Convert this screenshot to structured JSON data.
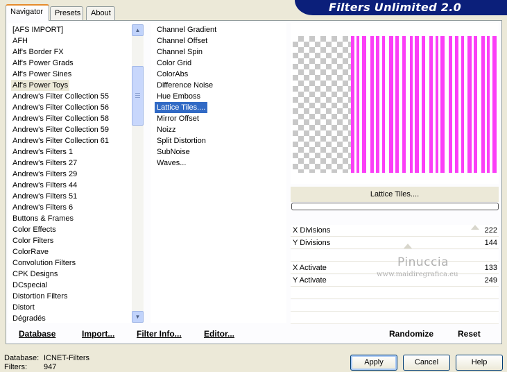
{
  "app": {
    "title": "Filters Unlimited 2.0"
  },
  "tabs": [
    {
      "label": "Navigator",
      "active": true
    },
    {
      "label": "Presets",
      "active": false
    },
    {
      "label": "About",
      "active": false
    }
  ],
  "categories": {
    "selected": "Alf's Power Toys",
    "items": [
      "[AFS IMPORT]",
      "AFH",
      "Alf's Border FX",
      "Alf's Power Grads",
      "Alf's Power Sines",
      "Alf's Power Toys",
      "Andrew's Filter Collection 55",
      "Andrew's Filter Collection 56",
      "Andrew's Filter Collection 58",
      "Andrew's Filter Collection 59",
      "Andrew's Filter Collection 61",
      "Andrew's Filters 1",
      "Andrew's Filters 27",
      "Andrew's Filters 29",
      "Andrew's Filters 44",
      "Andrew's Filters 51",
      "Andrew's Filters 6",
      "Buttons & Frames",
      "Color Effects",
      "Color Filters",
      "ColorRave",
      "Convolution Filters",
      "CPK Designs",
      "DCspecial",
      "Distortion Filters",
      "Distort",
      "Dégradés"
    ]
  },
  "filters": {
    "selected": "Lattice Tiles....",
    "items": [
      "Channel Gradient",
      "Channel Offset",
      "Channel Spin",
      "Color Grid",
      "ColorAbs",
      "Difference Noise",
      "Hue Emboss",
      "Lattice Tiles....",
      "Mirror Offset",
      "Noizz",
      "Split Distortion",
      "SubNoise",
      "Waves..."
    ]
  },
  "preview": {
    "filter_name": "Lattice Tiles....",
    "stripe_color": "#fb3ef7"
  },
  "parameters": [
    {
      "label": "X Divisions",
      "value": "222"
    },
    {
      "label": "Y Divisions",
      "value": "144"
    },
    {
      "label": "X Activate",
      "value": "133"
    },
    {
      "label": "Y Activate",
      "value": "249"
    }
  ],
  "watermark": {
    "title": "Pinuccia",
    "url": "www.maidiregrafica.eu"
  },
  "toolbar": {
    "database": "Database",
    "import": "Import...",
    "filter_info": "Filter Info...",
    "editor": "Editor...",
    "randomize": "Randomize",
    "reset": "Reset"
  },
  "status": {
    "database_label": "Database:",
    "database_value": "ICNET-Filters",
    "filters_label": "Filters:",
    "filters_value": "947"
  },
  "dialog": {
    "apply": "Apply",
    "cancel": "Cancel",
    "help": "Help"
  }
}
